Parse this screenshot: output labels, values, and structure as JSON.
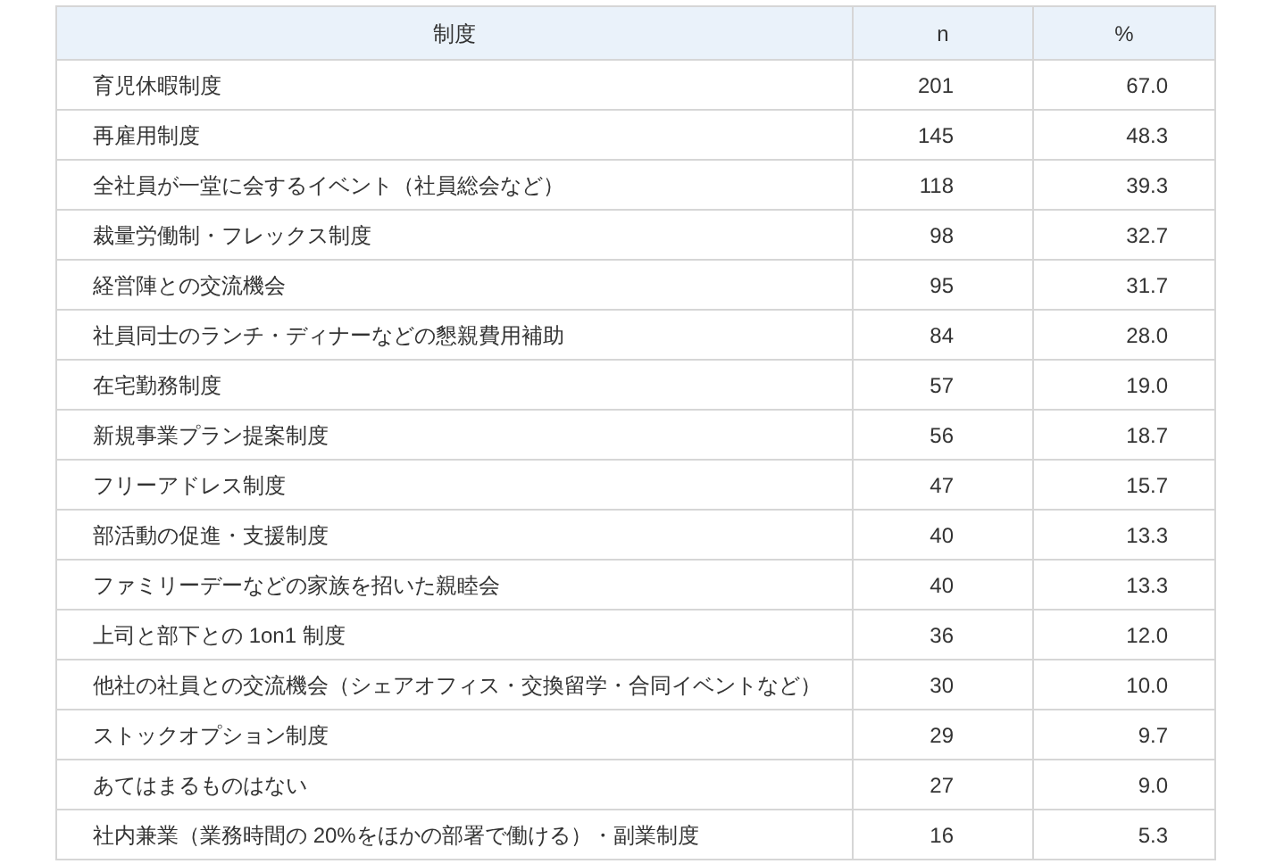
{
  "table": {
    "columns": [
      "制度",
      "n",
      "%"
    ],
    "rows": [
      [
        "育児休暇制度",
        "201",
        "67.0"
      ],
      [
        "再雇用制度",
        "145",
        "48.3"
      ],
      [
        "全社員が一堂に会するイベント（社員総会など）",
        "118",
        "39.3"
      ],
      [
        "裁量労働制・フレックス制度",
        "98",
        "32.7"
      ],
      [
        "経営陣との交流機会",
        "95",
        "31.7"
      ],
      [
        "社員同士のランチ・ディナーなどの懇親費用補助",
        "84",
        "28.0"
      ],
      [
        "在宅勤務制度",
        "57",
        "19.0"
      ],
      [
        "新規事業プラン提案制度",
        "56",
        "18.7"
      ],
      [
        "フリーアドレス制度",
        "47",
        "15.7"
      ],
      [
        "部活動の促進・支援制度",
        "40",
        "13.3"
      ],
      [
        "ファミリーデーなどの家族を招いた親睦会",
        "40",
        "13.3"
      ],
      [
        "上司と部下との 1on1 制度",
        "36",
        "12.0"
      ],
      [
        "他社の社員との交流機会（シェアオフィス・交換留学・合同イベントなど）",
        "30",
        "10.0"
      ],
      [
        "ストックオプション制度",
        "29",
        "9.7"
      ],
      [
        "あてはまるものはない",
        "27",
        "9.0"
      ],
      [
        "社内兼業（業務時間の 20%をほかの部署で働ける）・副業制度",
        "16",
        "5.3"
      ]
    ]
  }
}
